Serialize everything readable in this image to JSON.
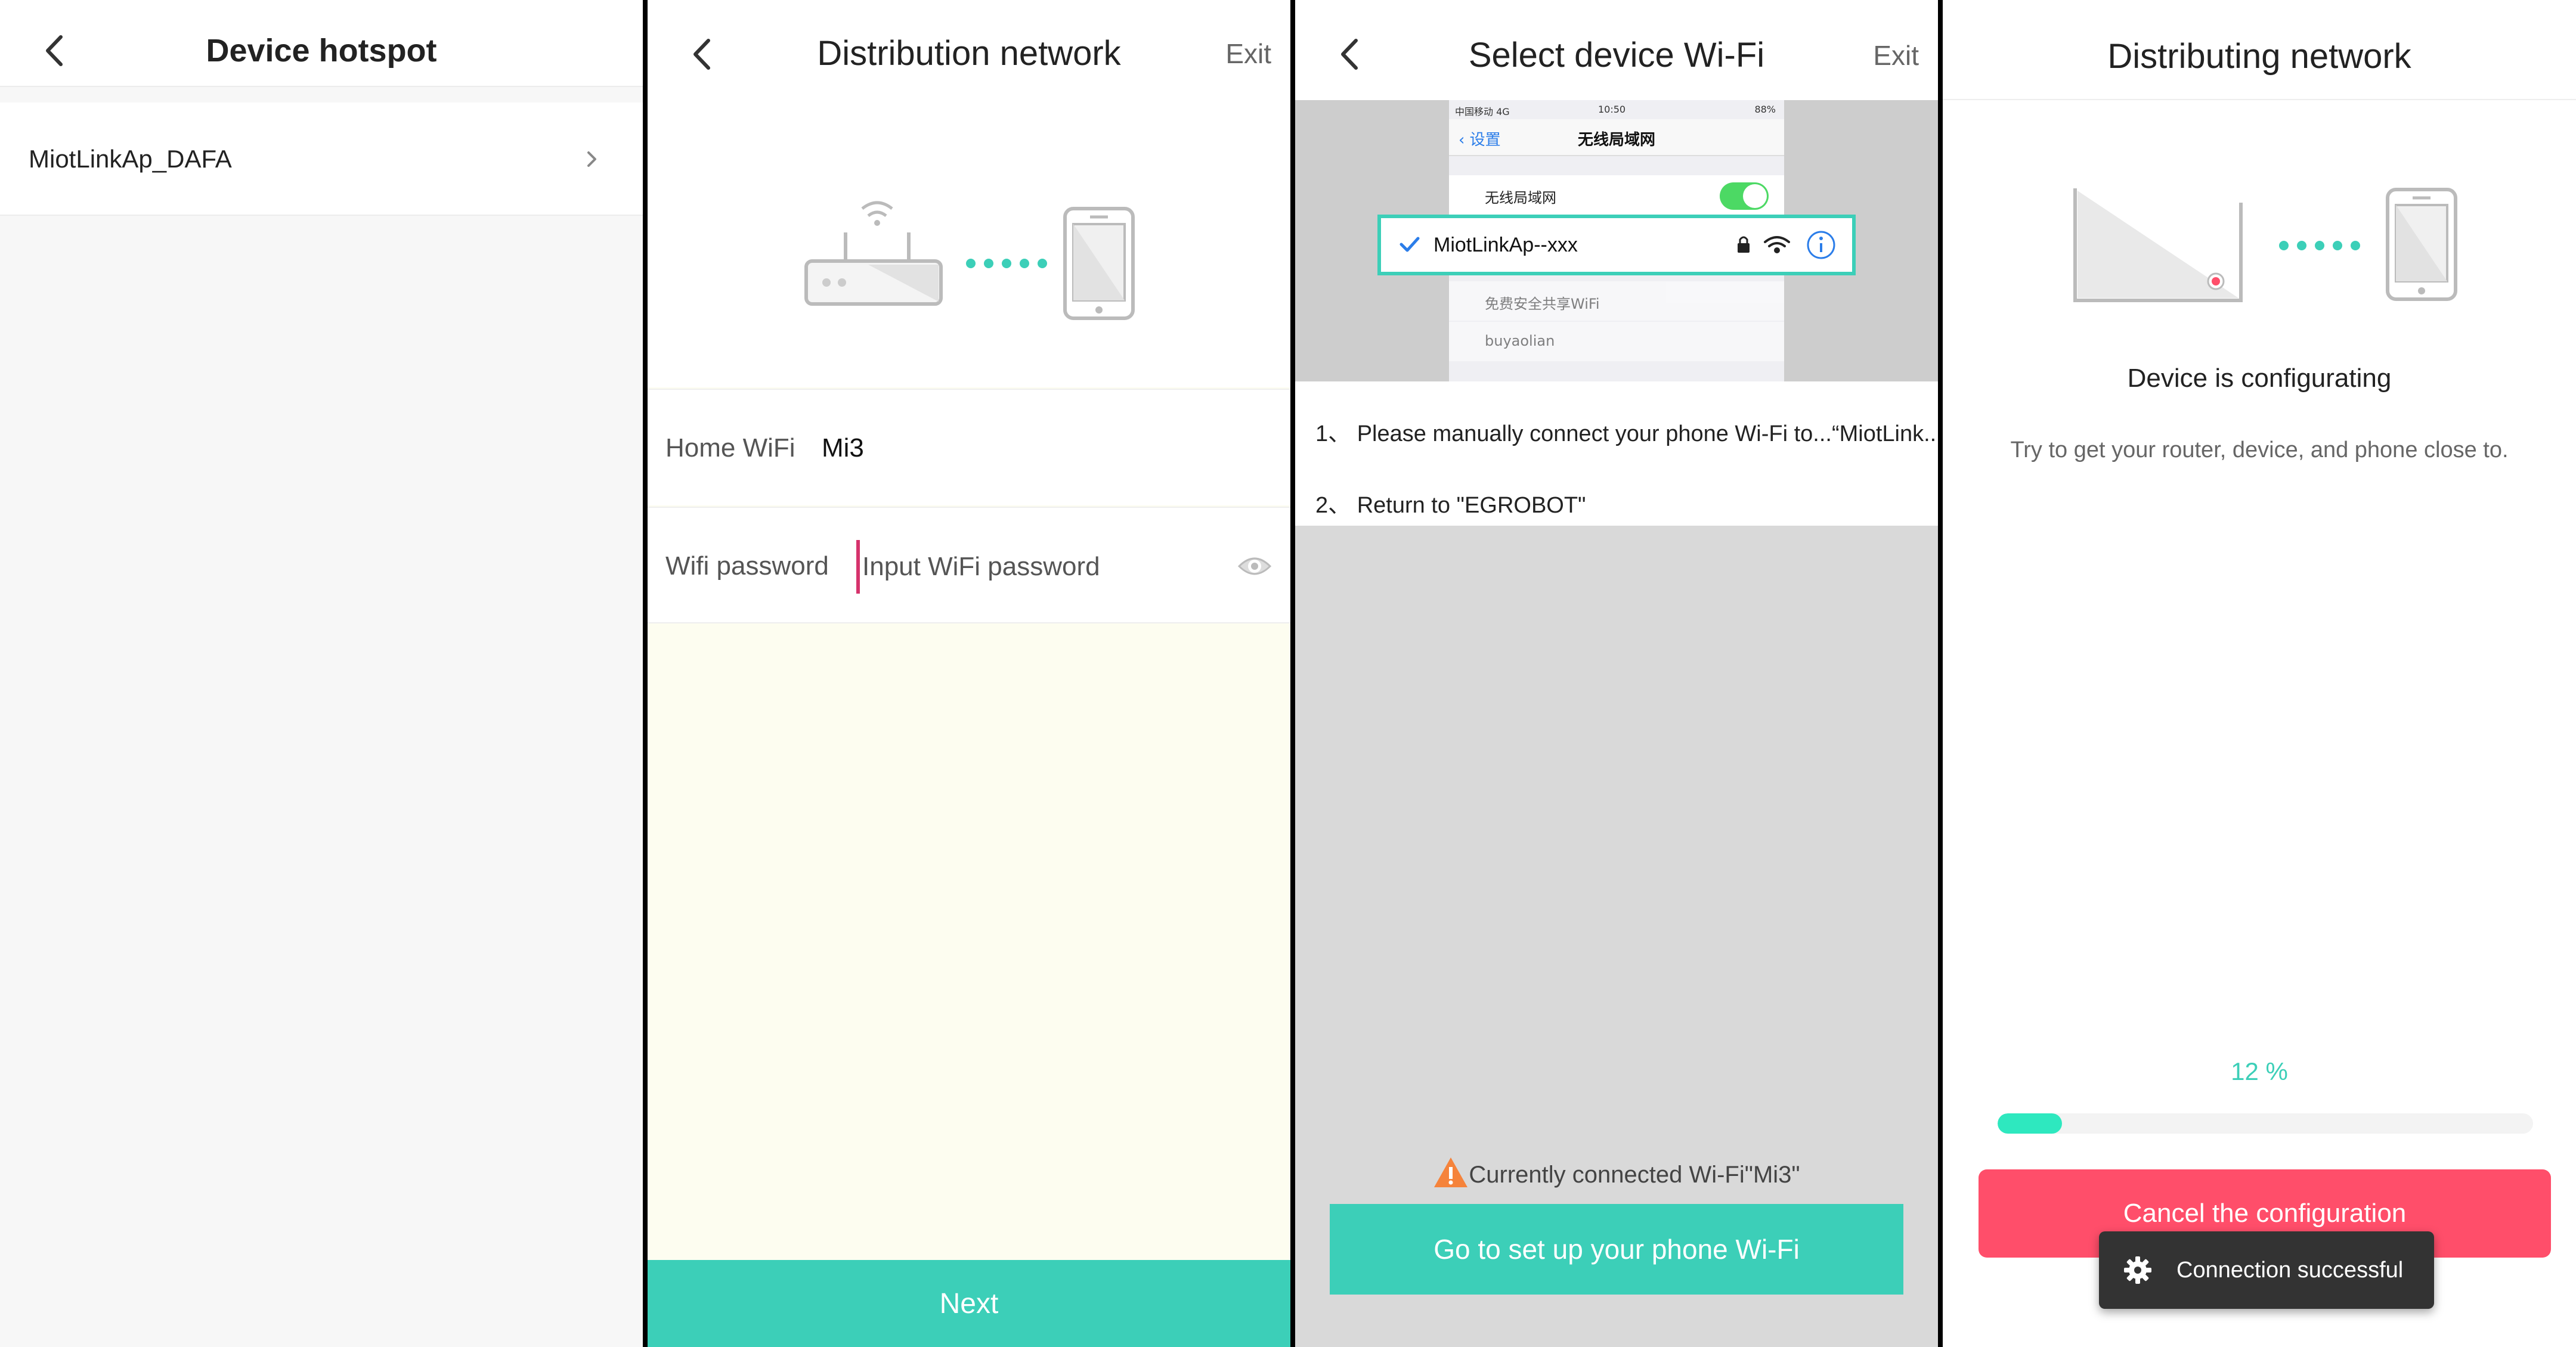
{
  "colors": {
    "accent": "#3ccfb8",
    "danger": "#ff4e6a",
    "progress": "#2ee8bf",
    "warning": "#f5833b"
  },
  "panel1": {
    "title": "Device hotspot",
    "items": [
      {
        "label": "MiotLinkAp_DAFA"
      }
    ]
  },
  "panel2": {
    "title": "Distribution network",
    "exit_label": "Exit",
    "home_wifi_label": "Home WiFi",
    "home_wifi_value": "Mi3",
    "password_label": "Wifi password",
    "password_placeholder": "Input WiFi password",
    "next_label": "Next"
  },
  "panel3": {
    "title": "Select device Wi-Fi",
    "exit_label": "Exit",
    "screenshot": {
      "carrier": "中国移动 4G",
      "time": "10:50",
      "battery": "88%",
      "back_label": "设置",
      "nav_title": "无线局域网",
      "wlan_label": "无线局域网",
      "selected_network": "MiotLinkAp--xxx",
      "other_networks": [
        "免费安全共享WiFi",
        "buyaolian"
      ]
    },
    "steps": [
      "1、 Please manually connect your phone Wi-Fi to...“MiotLink...",
      "2、 Return to \"EGROBOT\""
    ],
    "connected_text": "Currently connected Wi-Fi\"Mi3\"",
    "goto_label": "Go to set up your phone Wi-Fi"
  },
  "panel4": {
    "title": "Distributing network",
    "status_title": "Device is configurating",
    "status_subtitle": "Try to get your router, device, and phone close to.",
    "progress_percent": 12,
    "progress_text": "12 %",
    "cancel_label": "Cancel the configuration",
    "toast_text": "Connection successful"
  }
}
